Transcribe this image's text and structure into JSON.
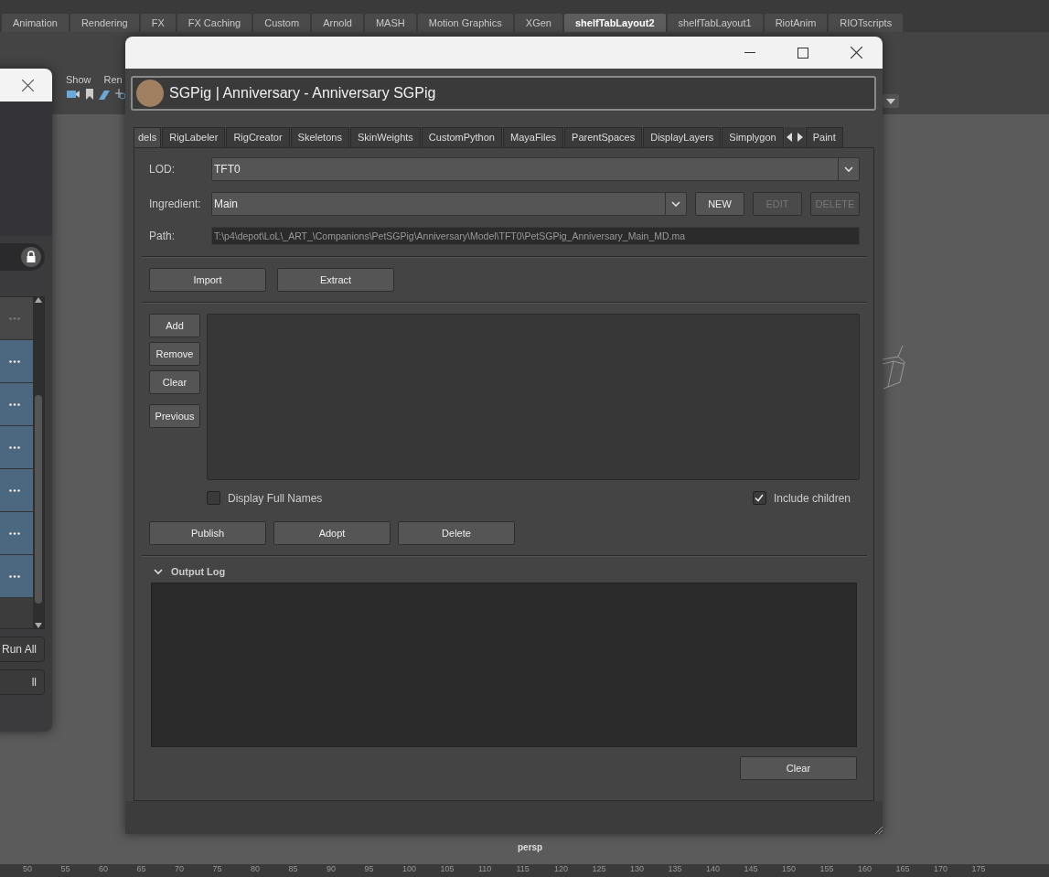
{
  "shelf_tabs": [
    {
      "label": "Animation",
      "selected": false
    },
    {
      "label": "Rendering",
      "selected": false
    },
    {
      "label": "FX",
      "selected": false
    },
    {
      "label": "FX Caching",
      "selected": false
    },
    {
      "label": "Custom",
      "selected": false
    },
    {
      "label": "Arnold",
      "selected": false
    },
    {
      "label": "MASH",
      "selected": false
    },
    {
      "label": "Motion Graphics",
      "selected": false
    },
    {
      "label": "XGen",
      "selected": false
    },
    {
      "label": "shelfTabLayout2",
      "selected": true
    },
    {
      "label": "shelfTabLayout1",
      "selected": false
    },
    {
      "label": "RiotAnim",
      "selected": false
    },
    {
      "label": "RIOTscripts",
      "selected": false
    }
  ],
  "viewport": {
    "menu": [
      "Show",
      "Ren"
    ],
    "camera": "persp"
  },
  "left_window": {
    "rows": [
      {
        "selected": false
      },
      {
        "selected": true
      },
      {
        "selected": true
      },
      {
        "selected": true
      },
      {
        "selected": true
      },
      {
        "selected": true
      },
      {
        "selected": true
      }
    ],
    "buttons": [
      "Run All",
      "ll"
    ]
  },
  "main_window": {
    "header_title": "SGPig | Anniversary - Anniversary SGPig",
    "tabs": [
      {
        "label": "dels",
        "selected": true
      },
      {
        "label": "RigLabeler",
        "selected": false
      },
      {
        "label": "RigCreator",
        "selected": false
      },
      {
        "label": "Skeletons",
        "selected": false
      },
      {
        "label": "SkinWeights",
        "selected": false
      },
      {
        "label": "CustomPython",
        "selected": false
      },
      {
        "label": "MayaFiles",
        "selected": false
      },
      {
        "label": "ParentSpaces",
        "selected": false
      },
      {
        "label": "DisplayLayers",
        "selected": false
      },
      {
        "label": "Simplygon",
        "selected": false
      },
      {
        "label": "Paint",
        "selected": false
      }
    ],
    "lod": {
      "label": "LOD:",
      "value": "TFT0"
    },
    "ingredient": {
      "label": "Ingredient:",
      "value": "Main",
      "buttons": [
        {
          "label": "NEW",
          "disabled": false
        },
        {
          "label": "EDIT",
          "disabled": true
        },
        {
          "label": "DELETE",
          "disabled": true
        }
      ]
    },
    "path": {
      "label": "Path:",
      "value": "T:\\p4\\depot\\LoL\\_ART_\\Companions\\PetSGPig\\Anniversary\\Model\\TFT0\\PetSGPig_Anniversary_Main_MD.ma"
    },
    "file_buttons": [
      "Import",
      "Extract"
    ],
    "list_buttons": [
      "Add",
      "Remove",
      "Clear",
      "Previous"
    ],
    "checkboxes": [
      {
        "label": "Display Full Names",
        "checked": false
      },
      {
        "label": "Include children",
        "checked": true
      }
    ],
    "action_buttons": [
      "Publish",
      "Adopt",
      "Delete"
    ],
    "output_log": {
      "title": "Output Log",
      "expanded": true,
      "clear_button": "Clear"
    }
  },
  "timeline": [
    "50",
    "55",
    "60",
    "65",
    "70",
    "75",
    "80",
    "85",
    "90",
    "95",
    "100",
    "105",
    "110",
    "115",
    "120",
    "125",
    "130",
    "135",
    "140",
    "145",
    "150",
    "155",
    "160",
    "165",
    "170",
    "175"
  ]
}
